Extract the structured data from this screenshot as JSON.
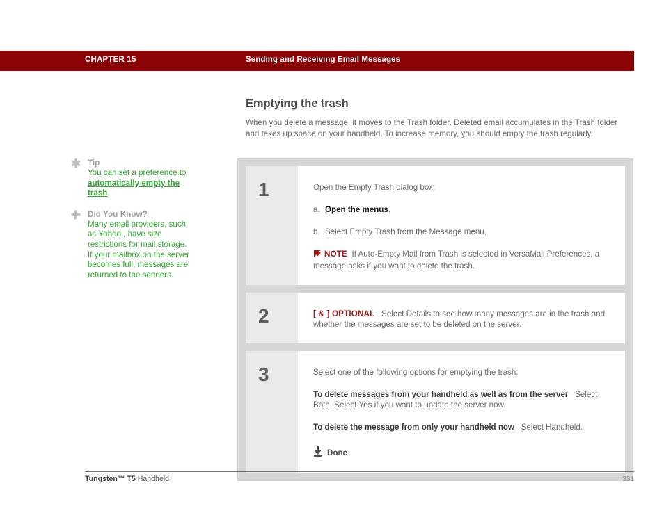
{
  "header": {
    "chapter": "CHAPTER 15",
    "title": "Sending and Receiving Email Messages",
    "bar_color": "#8c0306"
  },
  "main": {
    "heading": "Emptying the trash",
    "intro": "When you delete a message, it moves to the Trash folder. Deleted email accumulates in the Trash folder and takes up space on your handheld. To increase memory, you should empty the trash regularly."
  },
  "sidebar": {
    "blocks": [
      {
        "icon": "asterisk-icon",
        "icon_glyph": "✱",
        "heading": "Tip",
        "text_before": "You can set a preference to ",
        "link": "automatically empty the trash",
        "text_after": "."
      },
      {
        "icon": "plus-icon",
        "icon_glyph": "✚",
        "heading": "Did You Know?",
        "text_before": "Many email providers, such as Yahoo!, have size restrictions for mail storage. If your mailbox on the server becomes full, messages are returned to the senders.",
        "link": "",
        "text_after": ""
      }
    ],
    "text_color": "#2fab2f"
  },
  "steps": [
    {
      "number": "1",
      "lead": "Open the Empty Trash dialog box:",
      "subs": [
        {
          "marker": "a.",
          "link": "Open the menus",
          "after": "."
        },
        {
          "marker": "b.",
          "link": "",
          "after": "Select Empty Trash from the Message menu."
        }
      ],
      "note_label": "NOTE",
      "note_text": "If Auto-Empty Mail from Trash is selected in VersaMail Preferences, a message asks if you want to delete the trash."
    },
    {
      "number": "2",
      "optional_label": "[ & ] OPTIONAL",
      "optional_text": "Select Details to see how many messages are in the trash and whether the messages are set to be deleted on the server."
    },
    {
      "number": "3",
      "lead": "Select one of the following options for emptying the trash:",
      "options": [
        {
          "bold": "To delete messages from your handheld as well as from the server",
          "rest": "Select Both. Select Yes if you want to update the server now."
        },
        {
          "bold": "To delete the message from only your handheld now",
          "rest": "Select Handheld."
        }
      ],
      "done_label": "Done",
      "done_icon": "down-arrow-icon"
    }
  ],
  "footer": {
    "product_bold": "Tungsten™ T5",
    "product_rest": " Handheld",
    "page_number": "331"
  }
}
